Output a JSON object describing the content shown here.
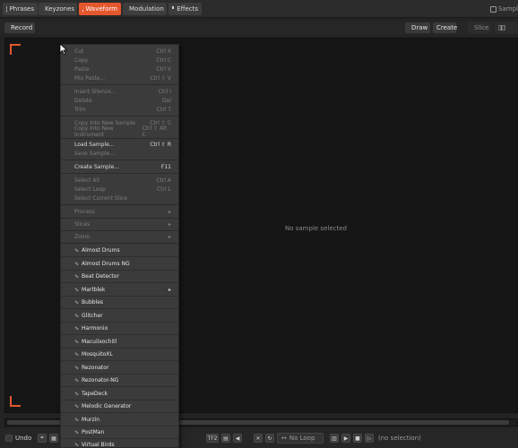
{
  "tabs": [
    {
      "label": "Phrases",
      "icon": "phrases-icon",
      "active": false
    },
    {
      "label": "Keyzones",
      "icon": "keyzones-icon",
      "active": false
    },
    {
      "label": "Waveform",
      "icon": "waveform-icon",
      "active": true
    },
    {
      "label": "Modulation",
      "icon": "modulation-icon",
      "active": false
    },
    {
      "label": "Effects",
      "icon": "effects-icon",
      "active": false
    }
  ],
  "tab_right_label": "Sampl",
  "toolbar": {
    "record_label": "Record",
    "draw_label": "Draw",
    "create_label": "Create",
    "slice_label": "Slice"
  },
  "waveform": {
    "empty_text": "No sample selected"
  },
  "bottom": {
    "undo_label": "Undo",
    "loop_label": "No Loop",
    "selection_text": "(no selection)",
    "misc_label": "TF2"
  },
  "menu": {
    "items": [
      {
        "label": "Cut",
        "shortcut": "Ctrl X",
        "disabled": true
      },
      {
        "label": "Copy",
        "shortcut": "Ctrl C",
        "disabled": true
      },
      {
        "label": "Paste",
        "shortcut": "Ctrl V",
        "disabled": true
      },
      {
        "label": "Mix Paste...",
        "shortcut": "Ctrl ⇧ V",
        "disabled": true
      },
      {
        "label": "Insert Silence...",
        "shortcut": "Ctrl I",
        "disabled": true
      },
      {
        "label": "Delete",
        "shortcut": "Del",
        "disabled": true
      },
      {
        "label": "Trim",
        "shortcut": "Ctrl T",
        "disabled": true
      },
      {
        "label": "Copy Into New Sample",
        "shortcut": "Ctrl ⇧ C",
        "disabled": true
      },
      {
        "label": "Copy Into New Instrument",
        "shortcut": "Ctrl ⇧ Alt C",
        "disabled": true
      },
      {
        "label": "Load Sample...",
        "shortcut": "Ctrl ⇧ R",
        "disabled": false
      },
      {
        "label": "Save Sample...",
        "shortcut": "",
        "disabled": true
      },
      {
        "label": "Create Sample...",
        "shortcut": "F11",
        "disabled": false
      },
      {
        "label": "Select All",
        "shortcut": "Ctrl A",
        "disabled": true
      },
      {
        "label": "Select Loop",
        "shortcut": "Ctrl L",
        "disabled": true
      },
      {
        "label": "Select Current Slice",
        "shortcut": "",
        "disabled": true
      },
      {
        "label": "Process",
        "shortcut": "",
        "disabled": true,
        "submenu": true
      },
      {
        "label": "Slices",
        "shortcut": "",
        "disabled": true,
        "submenu": true
      },
      {
        "label": "Zoom",
        "shortcut": "",
        "disabled": true,
        "submenu": true
      }
    ],
    "plugins": [
      {
        "label": "Almost Drums",
        "submenu": false
      },
      {
        "label": "Almost Drums NG",
        "submenu": false
      },
      {
        "label": "Beat Detector",
        "submenu": false
      },
      {
        "label": "Martblek",
        "submenu": true
      },
      {
        "label": "Bubbles",
        "submenu": false
      },
      {
        "label": "Glitcher",
        "submenu": false
      },
      {
        "label": "Harmonio",
        "submenu": false
      },
      {
        "label": "Macuilxochitl",
        "submenu": false
      },
      {
        "label": "MosquitoXL",
        "submenu": false
      },
      {
        "label": "Rezonator",
        "submenu": false
      },
      {
        "label": "Rezonator-NG",
        "submenu": false
      },
      {
        "label": "TapeDeck",
        "submenu": false
      },
      {
        "label": "Melodic Generator",
        "submenu": false
      },
      {
        "label": "Murzin",
        "submenu": false
      },
      {
        "label": "PostMan",
        "submenu": false
      },
      {
        "label": "Virtual Birds",
        "submenu": false
      }
    ]
  },
  "colors": {
    "accent": "#e4572e",
    "panel": "#232323",
    "menu_bg": "#3b3b3b"
  }
}
